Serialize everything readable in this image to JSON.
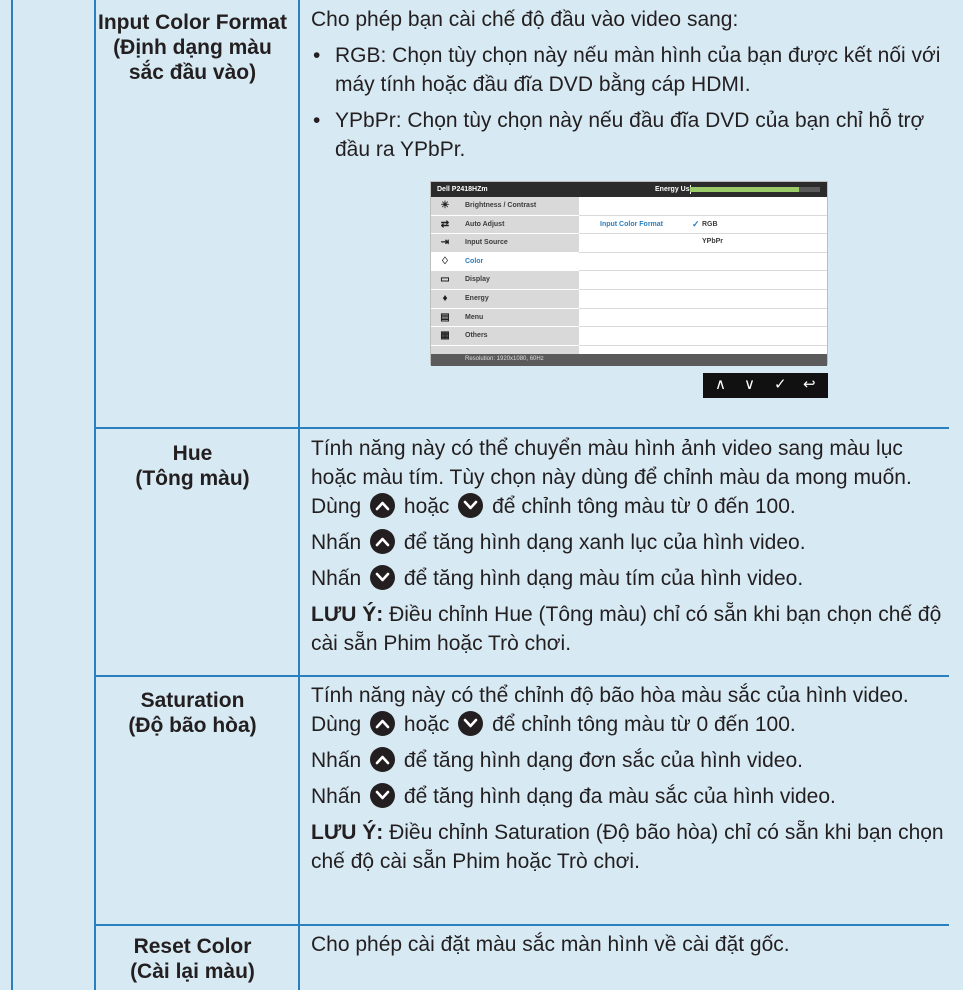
{
  "rows": [
    {
      "label_en": "Input Color Format",
      "label_vi": "(Định dạng màu sắc đầu vào)",
      "intro": "Cho phép bạn cài chế độ đầu vào video sang:",
      "bullets": [
        "RGB: Chọn tùy chọn này nếu màn hình của bạn được kết nối với máy tính hoặc đầu đĩa DVD bằng cáp HDMI.",
        "YPbPr: Chọn tùy chọn này nếu đầu đĩa DVD của bạn chỉ hỗ trợ đầu ra YPbPr."
      ]
    },
    {
      "label_en": "Hue",
      "label_vi": "(Tông màu)",
      "p1_a": "Tính năng này có thể chuyển màu hình ảnh video sang màu lục hoặc màu tím. Tùy chọn này dùng để chỉnh màu da mong muốn. Dùng",
      "p1_b": "hoặc",
      "p1_c": "để chỉnh tông màu từ 0 đến 100.",
      "p2_a": "Nhấn",
      "p2_b": "để tăng hình dạng xanh lục của hình video.",
      "p3_a": "Nhấn",
      "p3_b": "để tăng hình dạng màu tím của hình video.",
      "note_label": "LƯU Ý:",
      "note_text": "Điều chỉnh Hue (Tông màu) chỉ có sẵn khi bạn chọn chế độ cài sẵn Phim hoặc Trò chơi."
    },
    {
      "label_en": "Saturation",
      "label_vi": "(Độ bão hòa)",
      "p1_a": "Tính năng này có thể chỉnh độ bão hòa màu sắc của hình video. Dùng",
      "p1_b": "hoặc",
      "p1_c": "để chỉnh tông màu từ 0 đến 100.",
      "p2_a": "Nhấn",
      "p2_b": "để tăng hình dạng đơn sắc của hình video.",
      "p3_a": "Nhấn",
      "p3_b": "để tăng hình dạng đa màu sắc của hình video.",
      "note_label": "LƯU Ý:",
      "note_text": "Điều chỉnh Saturation (Độ bão hòa) chỉ có sẵn khi bạn chọn chế độ cài sẵn Phim hoặc Trò chơi."
    },
    {
      "label_en": "Reset Color",
      "label_vi": "(Cài lại màu)",
      "text": "Cho phép cài đặt màu sắc màn hình về cài đặt gốc."
    }
  ],
  "osd": {
    "model": "Dell P2418HZm",
    "energy_label": "Energy Use",
    "energy_level": 0.84,
    "menu": [
      {
        "label": "Brightness / Contrast",
        "icon": "brightness-icon"
      },
      {
        "label": "Auto Adjust",
        "icon": "auto-adjust-icon"
      },
      {
        "label": "Input Source",
        "icon": "input-source-icon"
      },
      {
        "label": "Color",
        "icon": "color-icon",
        "selected": true
      },
      {
        "label": "Display",
        "icon": "display-icon"
      },
      {
        "label": "Energy",
        "icon": "energy-icon"
      },
      {
        "label": "Menu",
        "icon": "menu-icon"
      },
      {
        "label": "Others",
        "icon": "others-icon"
      }
    ],
    "option_label": "Input Color Format",
    "check": "✓",
    "options": [
      "RGB",
      "YPbPr"
    ],
    "resolution": "Resolution: 1920x1080, 60Hz",
    "nav": [
      "∧",
      "∨",
      "✓",
      "↩"
    ]
  },
  "colors": {
    "background": "#d7e9f3",
    "rule": "#2a7fbf",
    "text": "#231f20"
  }
}
